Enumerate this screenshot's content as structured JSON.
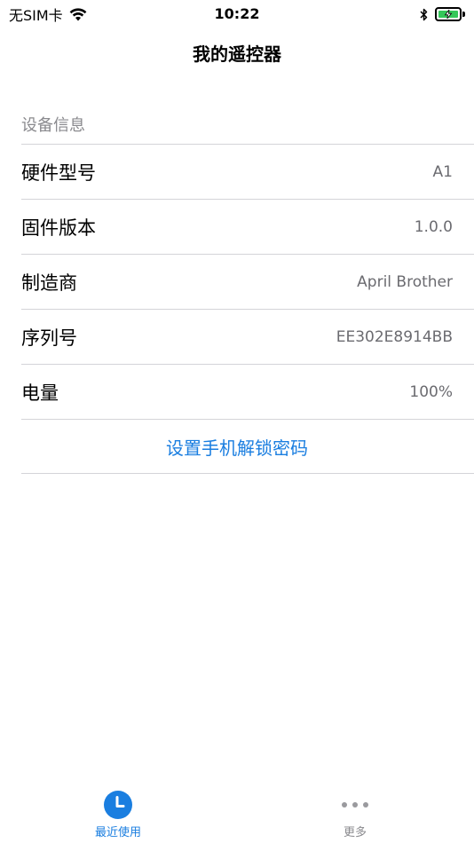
{
  "status_bar": {
    "carrier": "无SIM卡",
    "time": "10:22",
    "icons": [
      "wifi-icon",
      "bluetooth-icon",
      "battery-charging-icon"
    ],
    "battery_color": "#34c759"
  },
  "nav": {
    "title": "我的遥控器"
  },
  "device_info": {
    "header": "设备信息",
    "rows": [
      {
        "label": "硬件型号",
        "value": "A1"
      },
      {
        "label": "固件版本",
        "value": "1.0.0"
      },
      {
        "label": "制造商",
        "value": "April Brother"
      },
      {
        "label": "序列号",
        "value": "EE302E8914BB"
      },
      {
        "label": "电量",
        "value": "100%"
      }
    ],
    "action_label": "设置手机解锁密码"
  },
  "tab_bar": {
    "tabs": [
      {
        "label": "最近使用",
        "icon": "clock-icon",
        "selected": true
      },
      {
        "label": "更多",
        "icon": "more-dots-icon",
        "selected": false
      }
    ]
  },
  "colors": {
    "accent": "#1a7ee0",
    "secondary_text": "#8a8a8e",
    "separator": "#d4d4d8"
  }
}
